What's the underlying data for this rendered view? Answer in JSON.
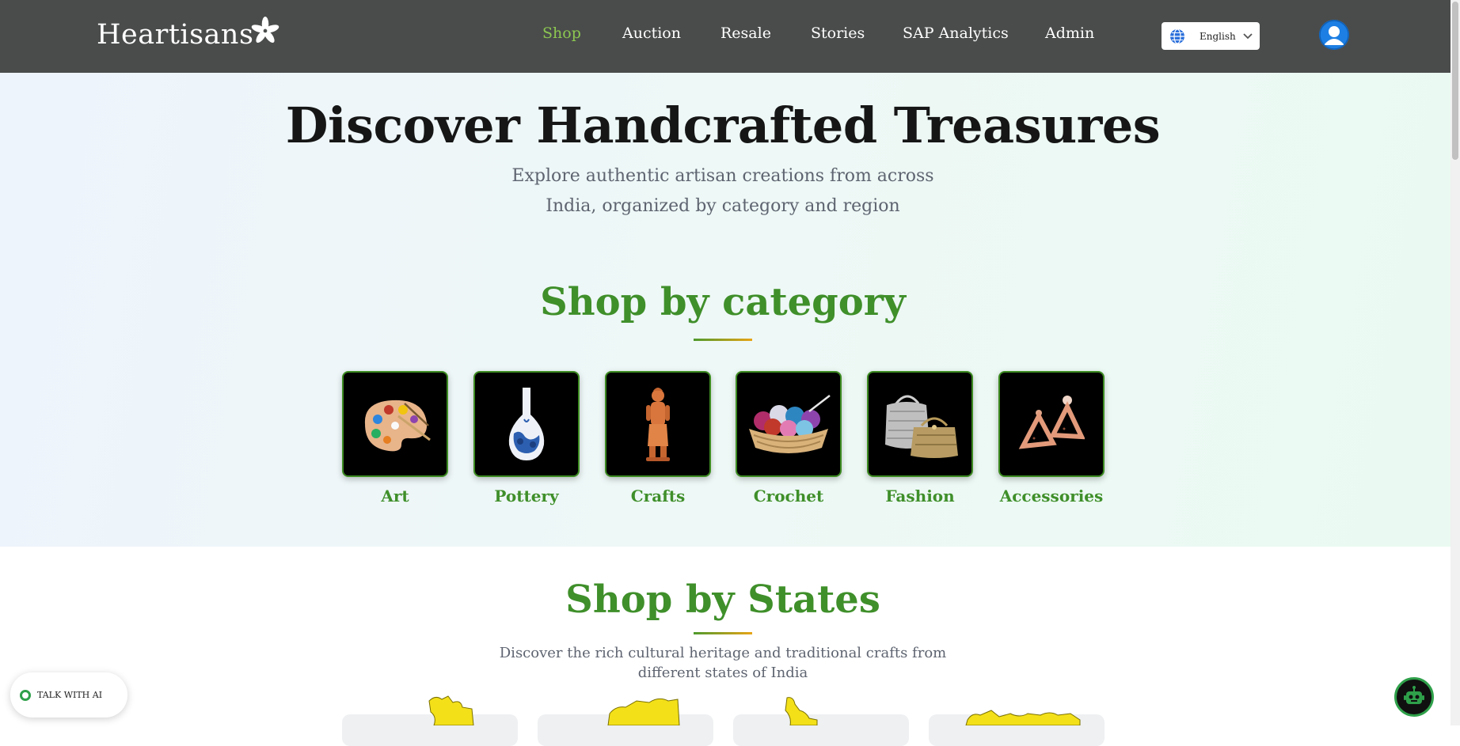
{
  "brand": {
    "name": "Heartisans"
  },
  "nav": {
    "items": [
      {
        "label": "Shop",
        "active": true
      },
      {
        "label": "Auction"
      },
      {
        "label": "Resale"
      },
      {
        "label": "Stories"
      },
      {
        "label": "SAP Analytics"
      },
      {
        "label": "Admin"
      }
    ],
    "language": "English"
  },
  "hero": {
    "title": "Discover Handcrafted Treasures",
    "subtitle_line1": "Explore authentic artisan creations from across",
    "subtitle_line2": "India, organized by category and region"
  },
  "categories": {
    "title": "Shop by category",
    "items": [
      {
        "label": "Art",
        "icon": "paint-palette-icon"
      },
      {
        "label": "Pottery",
        "icon": "vase-icon"
      },
      {
        "label": "Crafts",
        "icon": "terracotta-figurine-icon"
      },
      {
        "label": "Crochet",
        "icon": "yarn-basket-icon"
      },
      {
        "label": "Fashion",
        "icon": "handbag-icon"
      },
      {
        "label": "Accessories",
        "icon": "earrings-icon"
      }
    ]
  },
  "states": {
    "title": "Shop by States",
    "subtitle_line1": "Discover the rich cultural heritage and traditional crafts from",
    "subtitle_line2": "different states of India"
  },
  "chat": {
    "talk_label": "TALK WITH AI"
  },
  "colors": {
    "navbar": "#4a4c4b",
    "accent_green": "#3f8f2a",
    "active_nav": "#8cc751",
    "map_yellow": "#f3e019"
  }
}
